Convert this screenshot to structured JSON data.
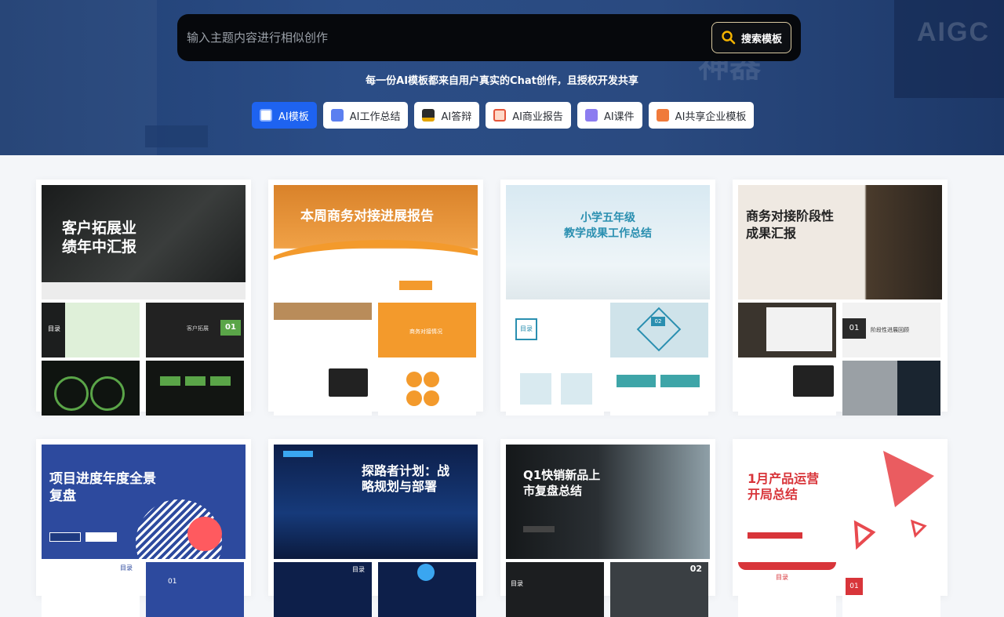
{
  "hero": {
    "search_placeholder": "输入主题内容进行相似创作",
    "search_button": "搜索模板",
    "subtitle": "每一份AI模板都来自用户真实的Chat创作，且授权开发共享",
    "bg_watermark": "AIGC",
    "bg_text": "神器"
  },
  "tabs": [
    {
      "label": "AI模板",
      "icon": "template-icon",
      "active": true
    },
    {
      "label": "AI工作总结",
      "icon": "summary-icon",
      "active": false
    },
    {
      "label": "AI答辩",
      "icon": "graduation-cap-icon",
      "active": false
    },
    {
      "label": "AI商业报告",
      "icon": "report-icon",
      "active": false
    },
    {
      "label": "AI课件",
      "icon": "book-icon",
      "active": false
    },
    {
      "label": "AI共享企业模板",
      "icon": "enterprise-icon",
      "active": false
    }
  ],
  "cards_row1": [
    {
      "title": "客户拓展业绩年中汇报",
      "line1": "客户拓展业",
      "line2": "绩年中汇报",
      "badge": "01",
      "t2": "目录",
      "t3": "客户拓展"
    },
    {
      "title": "本周商务对接进展报告",
      "line1": "本周商务对接进展报告",
      "t2": "商务对接情况"
    },
    {
      "title": "小学五年级教学成果工作总结",
      "line1": "小学五年级",
      "line2": "教学成果工作总结",
      "badge": "02",
      "t2": "目录"
    },
    {
      "title": "商务对接阶段性成果汇报",
      "line1": "商务对接阶段性",
      "line2": "成果汇报",
      "badge": "01",
      "t2": "阶段性进展回顾"
    }
  ],
  "cards_row2": [
    {
      "title": "项目进度年度全景复盘",
      "line1": "项目进度年度全景",
      "line2": "复盘",
      "t2": "目录",
      "badge": "01"
    },
    {
      "title": "探路者计划：战略规划与部署",
      "line1": "探路者计划：战",
      "line2": "略规划与部署",
      "t2": "目录"
    },
    {
      "title": "Q1快销新品上市复盘总结",
      "line1": "Q1快销新品上",
      "line2": "市复盘总结",
      "t2": "目录",
      "badge": "02"
    },
    {
      "title": "1月产品运营开局总结",
      "line1": "1月产品运营",
      "line2": "开局总结",
      "badge": "01",
      "t2": "目录"
    }
  ],
  "colors": {
    "accent": "#1e63f0",
    "hero_bg": "#2b4d86"
  }
}
